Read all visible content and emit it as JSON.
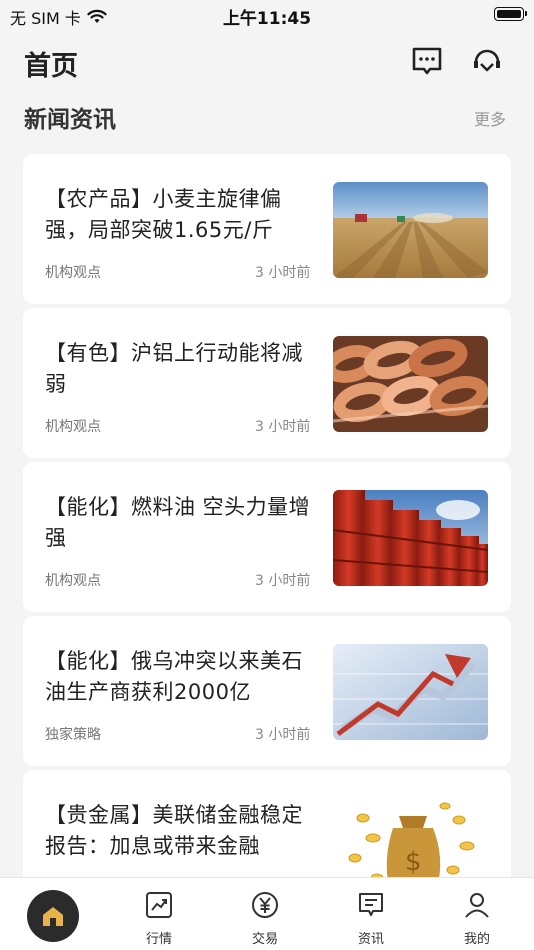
{
  "status_bar": {
    "carrier": "无 SIM 卡",
    "time": "上午11:45"
  },
  "header": {
    "title": "首页",
    "message_icon": "message-icon",
    "service_icon": "headset-icon"
  },
  "section": {
    "title": "新闻资讯",
    "more_label": "更多"
  },
  "news": [
    {
      "title": "【农产品】小麦主旋律偏强，局部突破1.65元/斤",
      "source": "机构观点",
      "time": "3 小时前",
      "thumb": "wheat-field-image"
    },
    {
      "title": "【有色】沪铝上行动能将减弱",
      "source": "机构观点",
      "time": "3 小时前",
      "thumb": "copper-coils-image"
    },
    {
      "title": "【能化】燃料油 空头力量增强",
      "source": "机构观点",
      "time": "3 小时前",
      "thumb": "oil-barrels-image"
    },
    {
      "title": "【能化】俄乌冲突以来美石油生产商获利2000亿",
      "source": "独家策略",
      "time": "3 小时前",
      "thumb": "rising-arrow-chart-image"
    },
    {
      "title": "【贵金属】美联储金融稳定报告：加息或带来金融",
      "source": "",
      "time": "",
      "thumb": "money-bag-image"
    }
  ],
  "tabs": [
    {
      "label": "",
      "icon": "home-icon"
    },
    {
      "label": "行情",
      "icon": "chart-icon"
    },
    {
      "label": "交易",
      "icon": "yuan-icon"
    },
    {
      "label": "资讯",
      "icon": "news-icon"
    },
    {
      "label": "我的",
      "icon": "user-icon"
    }
  ],
  "colors": {
    "accent_gold": "#e8b34a",
    "home_circle": "#2b2b2b",
    "background": "#f4f4f4"
  }
}
